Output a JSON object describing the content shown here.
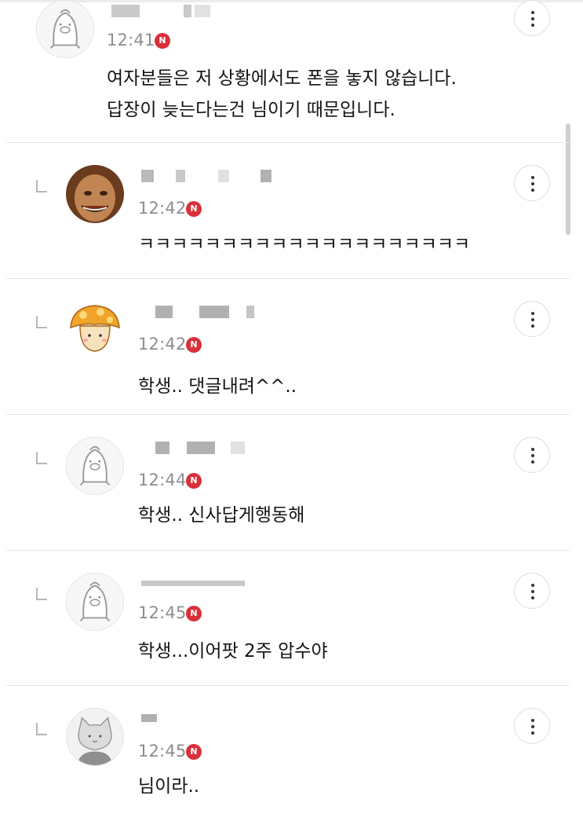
{
  "comments": [
    {
      "time": "12:41",
      "badge": "N",
      "text": "여자분들은 저 상황에서도 폰을 놓지 않습니다.\n답장이 늦는다는건 님이기 때문입니다.",
      "avatar": "penguin-icon"
    },
    {
      "time": "12:42",
      "badge": "N",
      "text": "ㅋㅋㅋㅋㅋㅋㅋㅋㅋㅋㅋㅋㅋㅋㅋㅋㅋㅋㅋㅋ",
      "avatar": "photo-face-avatar"
    },
    {
      "time": "12:42",
      "badge": "N",
      "text": "학생.. 댓글내려^^..",
      "avatar": "mushroom-icon"
    },
    {
      "time": "12:44",
      "badge": "N",
      "text": "학생.. 신사답게행동해",
      "avatar": "penguin-icon"
    },
    {
      "time": "12:45",
      "badge": "N",
      "text": "학생...이어팟 2주 압수야",
      "avatar": "penguin-icon"
    },
    {
      "time": "12:45",
      "badge": "N",
      "text": "님이라..",
      "avatar": "cat-icon"
    }
  ],
  "colors": {
    "badge": "#d9303a",
    "time": "#8e8e8e",
    "divider": "#e6e6e6"
  }
}
